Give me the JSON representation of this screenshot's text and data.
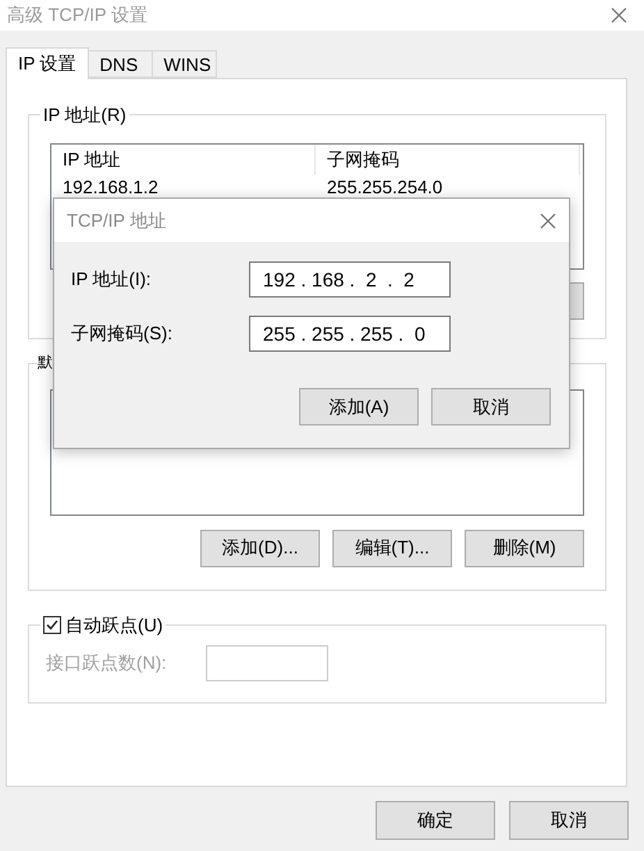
{
  "window": {
    "title": "高级 TCP/IP 设置"
  },
  "tabs": [
    {
      "label": "IP 设置",
      "selected": true
    },
    {
      "label": "DNS",
      "selected": false
    },
    {
      "label": "WINS",
      "selected": false
    }
  ],
  "ip_group": {
    "legend": "IP 地址(R)",
    "columns": [
      "IP 地址",
      "子网掩码"
    ],
    "rows": [
      [
        "192.168.1.2",
        "255.255.254.0"
      ]
    ]
  },
  "gateway_group": {
    "legend": "默",
    "buttons": [
      "添加(D)...",
      "编辑(T)...",
      "删除(M)"
    ]
  },
  "metric_group": {
    "checkbox": {
      "label": "自动跃点(U)",
      "checked": true
    },
    "field": {
      "label": "接口跃点数(N):",
      "disabled": true
    }
  },
  "buttons": [
    "确定",
    "取消"
  ],
  "dialog": {
    "title": "TCP/IP 地址",
    "fields": [
      {
        "label": "IP 地址(I):",
        "value": "192 . 168 .  2  .  2"
      },
      {
        "label": "子网掩码(S):",
        "value": "255 . 255 . 255 .  0"
      }
    ],
    "buttons": [
      "添加(A)",
      "取消"
    ]
  }
}
